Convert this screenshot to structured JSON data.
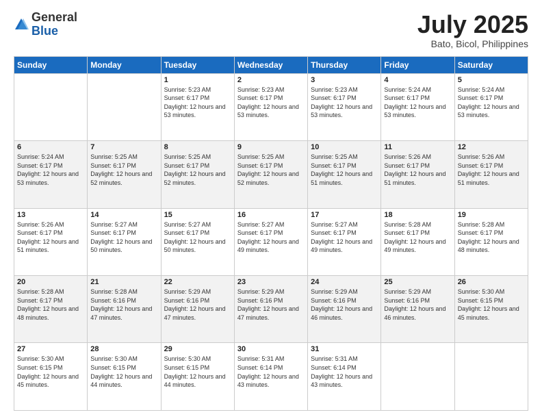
{
  "header": {
    "logo_general": "General",
    "logo_blue": "Blue",
    "month_title": "July 2025",
    "location": "Bato, Bicol, Philippines"
  },
  "days_of_week": [
    "Sunday",
    "Monday",
    "Tuesday",
    "Wednesday",
    "Thursday",
    "Friday",
    "Saturday"
  ],
  "weeks": [
    [
      null,
      null,
      {
        "day": 1,
        "sunrise": "5:23 AM",
        "sunset": "6:17 PM",
        "daylight": "12 hours and 53 minutes."
      },
      {
        "day": 2,
        "sunrise": "5:23 AM",
        "sunset": "6:17 PM",
        "daylight": "12 hours and 53 minutes."
      },
      {
        "day": 3,
        "sunrise": "5:23 AM",
        "sunset": "6:17 PM",
        "daylight": "12 hours and 53 minutes."
      },
      {
        "day": 4,
        "sunrise": "5:24 AM",
        "sunset": "6:17 PM",
        "daylight": "12 hours and 53 minutes."
      },
      {
        "day": 5,
        "sunrise": "5:24 AM",
        "sunset": "6:17 PM",
        "daylight": "12 hours and 53 minutes."
      }
    ],
    [
      {
        "day": 6,
        "sunrise": "5:24 AM",
        "sunset": "6:17 PM",
        "daylight": "12 hours and 53 minutes."
      },
      {
        "day": 7,
        "sunrise": "5:25 AM",
        "sunset": "6:17 PM",
        "daylight": "12 hours and 52 minutes."
      },
      {
        "day": 8,
        "sunrise": "5:25 AM",
        "sunset": "6:17 PM",
        "daylight": "12 hours and 52 minutes."
      },
      {
        "day": 9,
        "sunrise": "5:25 AM",
        "sunset": "6:17 PM",
        "daylight": "12 hours and 52 minutes."
      },
      {
        "day": 10,
        "sunrise": "5:25 AM",
        "sunset": "6:17 PM",
        "daylight": "12 hours and 51 minutes."
      },
      {
        "day": 11,
        "sunrise": "5:26 AM",
        "sunset": "6:17 PM",
        "daylight": "12 hours and 51 minutes."
      },
      {
        "day": 12,
        "sunrise": "5:26 AM",
        "sunset": "6:17 PM",
        "daylight": "12 hours and 51 minutes."
      }
    ],
    [
      {
        "day": 13,
        "sunrise": "5:26 AM",
        "sunset": "6:17 PM",
        "daylight": "12 hours and 51 minutes."
      },
      {
        "day": 14,
        "sunrise": "5:27 AM",
        "sunset": "6:17 PM",
        "daylight": "12 hours and 50 minutes."
      },
      {
        "day": 15,
        "sunrise": "5:27 AM",
        "sunset": "6:17 PM",
        "daylight": "12 hours and 50 minutes."
      },
      {
        "day": 16,
        "sunrise": "5:27 AM",
        "sunset": "6:17 PM",
        "daylight": "12 hours and 49 minutes."
      },
      {
        "day": 17,
        "sunrise": "5:27 AM",
        "sunset": "6:17 PM",
        "daylight": "12 hours and 49 minutes."
      },
      {
        "day": 18,
        "sunrise": "5:28 AM",
        "sunset": "6:17 PM",
        "daylight": "12 hours and 49 minutes."
      },
      {
        "day": 19,
        "sunrise": "5:28 AM",
        "sunset": "6:17 PM",
        "daylight": "12 hours and 48 minutes."
      }
    ],
    [
      {
        "day": 20,
        "sunrise": "5:28 AM",
        "sunset": "6:17 PM",
        "daylight": "12 hours and 48 minutes."
      },
      {
        "day": 21,
        "sunrise": "5:28 AM",
        "sunset": "6:16 PM",
        "daylight": "12 hours and 47 minutes."
      },
      {
        "day": 22,
        "sunrise": "5:29 AM",
        "sunset": "6:16 PM",
        "daylight": "12 hours and 47 minutes."
      },
      {
        "day": 23,
        "sunrise": "5:29 AM",
        "sunset": "6:16 PM",
        "daylight": "12 hours and 47 minutes."
      },
      {
        "day": 24,
        "sunrise": "5:29 AM",
        "sunset": "6:16 PM",
        "daylight": "12 hours and 46 minutes."
      },
      {
        "day": 25,
        "sunrise": "5:29 AM",
        "sunset": "6:16 PM",
        "daylight": "12 hours and 46 minutes."
      },
      {
        "day": 26,
        "sunrise": "5:30 AM",
        "sunset": "6:15 PM",
        "daylight": "12 hours and 45 minutes."
      }
    ],
    [
      {
        "day": 27,
        "sunrise": "5:30 AM",
        "sunset": "6:15 PM",
        "daylight": "12 hours and 45 minutes."
      },
      {
        "day": 28,
        "sunrise": "5:30 AM",
        "sunset": "6:15 PM",
        "daylight": "12 hours and 44 minutes."
      },
      {
        "day": 29,
        "sunrise": "5:30 AM",
        "sunset": "6:15 PM",
        "daylight": "12 hours and 44 minutes."
      },
      {
        "day": 30,
        "sunrise": "5:31 AM",
        "sunset": "6:14 PM",
        "daylight": "12 hours and 43 minutes."
      },
      {
        "day": 31,
        "sunrise": "5:31 AM",
        "sunset": "6:14 PM",
        "daylight": "12 hours and 43 minutes."
      },
      null,
      null
    ]
  ]
}
